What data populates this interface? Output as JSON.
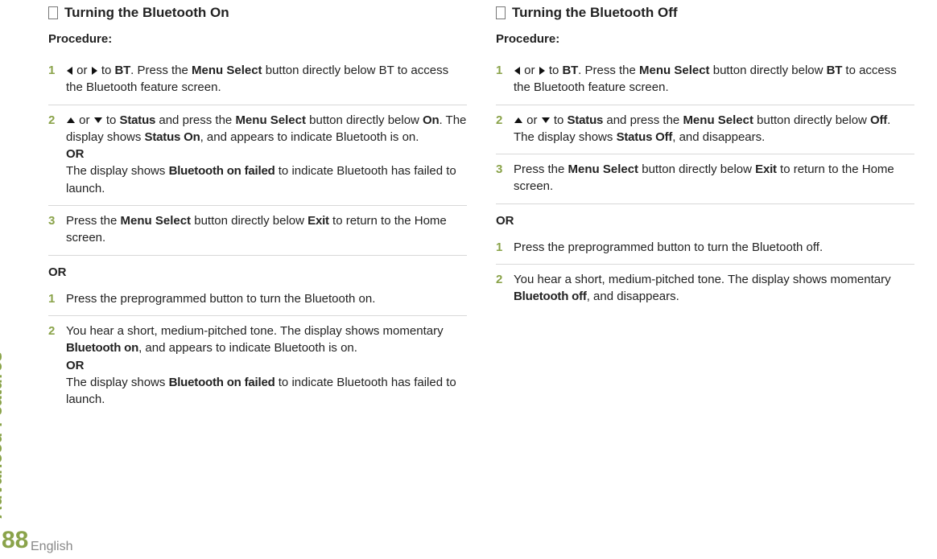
{
  "side_label": "Advanced Features",
  "page_number": "88",
  "language": "English",
  "left": {
    "heading": "Turning the Bluetooth On",
    "procedure": "Procedure:",
    "steps_a": [
      {
        "n": "1",
        "pre": "",
        "after_arrows": " to ",
        "bt": "BT",
        "t1": ". Press the ",
        "ms": "Menu Select",
        "t2": " button directly below BT to access the Bluetooth feature screen."
      },
      {
        "n": "2",
        "after_arrows": " to ",
        "status": "Status",
        "t1": " and press the ",
        "ms": "Menu Select",
        "t2": " button directly below ",
        "on": "On",
        "t3": ". The display shows ",
        "status_on": "Status On",
        "t4": ", and appears to indicate Bluetooth is on.",
        "or": "OR",
        "t5": "The display shows ",
        "failed": "Bluetooth on failed",
        "t6": " to indicate Bluetooth has failed to launch."
      },
      {
        "n": "3",
        "t1": "Press the ",
        "ms": "Menu Select",
        "t2": " button directly below ",
        "exit": "Exit",
        "t3": " to return to the Home screen."
      }
    ],
    "or": "OR",
    "steps_b": [
      {
        "n": "1",
        "t": "Press the preprogrammed button to turn the Bluetooth on."
      },
      {
        "n": "2",
        "t1": "You hear a short, medium-pitched tone. The display shows momentary ",
        "bon": "Bluetooth on",
        "t2": ", and    appears to indicate Bluetooth is on.",
        "or": "OR",
        "t3": "The display shows ",
        "failed": "Bluetooth on failed",
        "t4": " to indicate Bluetooth has failed to launch."
      }
    ]
  },
  "right": {
    "heading": "Turning the Bluetooth Off",
    "procedure": "Procedure:",
    "steps_a": [
      {
        "n": "1",
        "after_arrows": " to ",
        "bt": "BT",
        "t1": ". Press the ",
        "ms": "Menu Select",
        "t2": " button directly below ",
        "bt2": "BT",
        "t3": " to access the Bluetooth feature screen."
      },
      {
        "n": "2",
        "after_arrows": " to ",
        "status": "Status",
        "t1": " and press the ",
        "ms": "Menu Select",
        "t2": " button directly below ",
        "off": "Off",
        "t3": ". The display shows ",
        "status_off": "Status Off",
        "t4": ", and disappears."
      },
      {
        "n": "3",
        "t1": "Press the ",
        "ms": "Menu Select",
        "t2": " button directly below ",
        "exit": "Exit",
        "t3": " to return to the Home screen."
      }
    ],
    "or": "OR",
    "steps_b": [
      {
        "n": "1",
        "t": "Press the preprogrammed button to turn the Bluetooth off."
      },
      {
        "n": "2",
        "t1": "You hear a short, medium-pitched tone. The display shows momentary ",
        "boff": "Bluetooth off",
        "t2": ", and    disappears."
      }
    ]
  },
  "word_or": " or "
}
